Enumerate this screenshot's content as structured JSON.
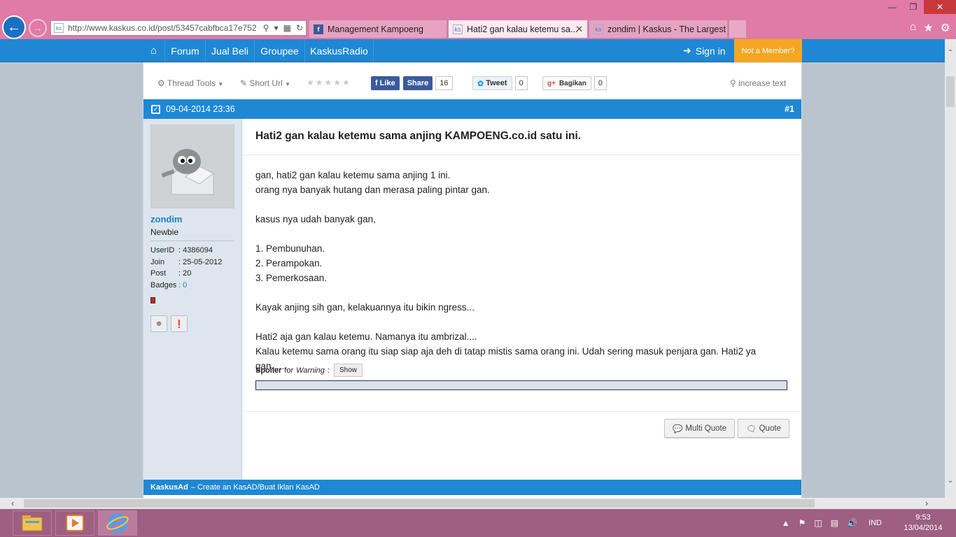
{
  "browser": {
    "url": "http://www.kaskus.co.id/post/53457cabfbca17e752",
    "tabs": [
      {
        "label": "Management Kampoeng"
      },
      {
        "label": "Hati2 gan kalau ketemu sa..."
      },
      {
        "label": "zondim | Kaskus - The Largest I..."
      }
    ]
  },
  "nav": {
    "items": [
      "Forum",
      "Jual Beli",
      "Groupee",
      "KaskusRadio"
    ],
    "signin": "Sign in",
    "member": "Not a Member?"
  },
  "toolbar": {
    "thread_tools": "Thread Tools",
    "short_url": "Short Url",
    "fb_like": "Like",
    "fb_share": "Share",
    "fb_count": "16",
    "tweet": "Tweet",
    "tweet_count": "0",
    "gplus": "Bagikan",
    "gplus_count": "0",
    "increase_text": "increase text"
  },
  "post": {
    "date": "09-04-2014 23:36",
    "number": "#1",
    "title": "Hati2 gan kalau ketemu sama anjing KAMPOENG.co.id satu ini.",
    "lines": [
      "gan, hati2 gan kalau ketemu sama anjing 1 ini.",
      "orang nya banyak hutang dan merasa paling pintar gan.",
      "",
      "kasus nya udah banyak gan,",
      "",
      "1. Pembunuhan.",
      "2. Perampokan.",
      "3. Pemerkosaan.",
      "",
      "Kayak anjing sih gan, kelakuannya itu bikin ngress...",
      "",
      "Hati2 aja gan kalau ketemu. Namanya itu ambrizal....",
      "Kalau ketemu sama orang itu siap siap aja deh di tatap mistis sama orang ini. Udah sering masuk penjara gan. Hati2 ya gan......"
    ],
    "spoiler_label": "Spoiler",
    "spoiler_for": "for",
    "spoiler_name": "Warning",
    "spoiler_show": "Show",
    "multi_quote": "Multi Quote",
    "quote": "Quote"
  },
  "user": {
    "name": "zondim",
    "rank": "Newbie",
    "stats": [
      {
        "key": "UserID",
        "value": ": 4386094"
      },
      {
        "key": "Join",
        "value": ": 25-05-2012"
      },
      {
        "key": "Post",
        "value": ": 20"
      },
      {
        "key": "Badges",
        "value": ": 0"
      }
    ]
  },
  "ad": {
    "brand": "KaskusAd",
    "text": "– Create an KasAD/Buat Iklan KasAD"
  },
  "taskbar": {
    "lang": "IND",
    "time": "9:53",
    "date": "13/04/2014"
  },
  "colors": {
    "chrome": "#e07aa6",
    "kaskus_blue": "#1e88d4",
    "member_orange": "#f5a623",
    "taskbar": "#9e5f82"
  }
}
